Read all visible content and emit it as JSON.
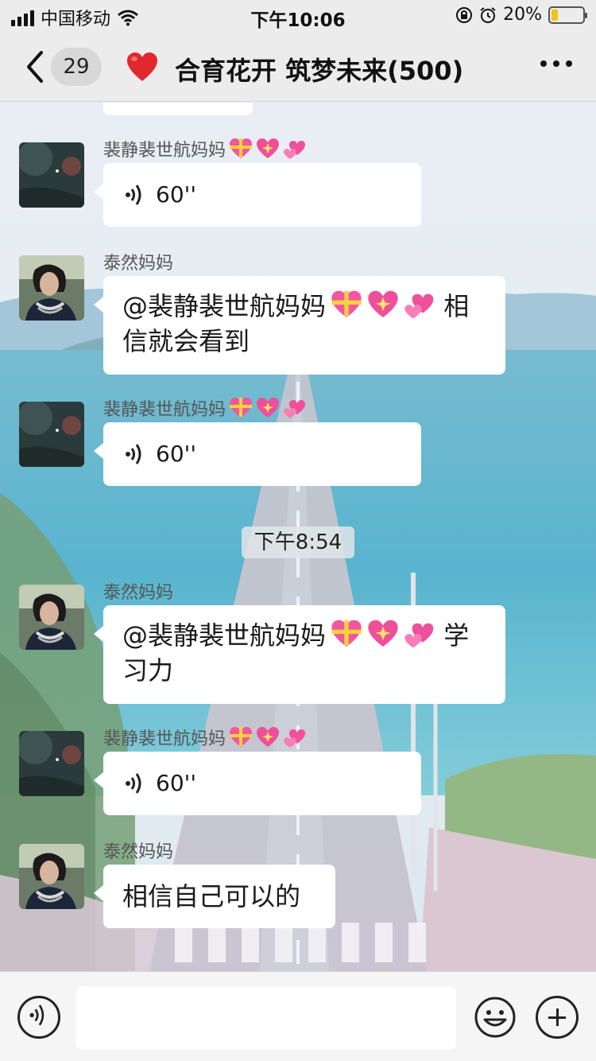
{
  "status_bar": {
    "carrier": "中国移动",
    "time": "下午10:06",
    "battery": "20%",
    "battery_level": 0.2
  },
  "header": {
    "unread_count": "29",
    "title": "合育花开 筑梦未来(500)"
  },
  "messages": [
    {
      "type": "voice",
      "sender": "裴静裴世航妈妈",
      "duration": "60''",
      "avatar": "dark-photo"
    },
    {
      "type": "text",
      "sender": "泰然妈妈",
      "text_line1": "@裴静裴世航妈妈",
      "text_tail": " 相",
      "text_line2": "信就会看到",
      "avatar": "woman-photo"
    },
    {
      "type": "voice",
      "sender": "裴静裴世航妈妈",
      "duration": "60''",
      "avatar": "dark-photo"
    },
    {
      "type": "text",
      "sender": "泰然妈妈",
      "text_line1": "@裴静裴世航妈妈",
      "text_tail": " 学",
      "text_line2": "习力",
      "avatar": "woman-photo"
    },
    {
      "type": "voice",
      "sender": "裴静裴世航妈妈",
      "duration": "60''",
      "avatar": "dark-photo"
    },
    {
      "type": "text",
      "sender": "泰然妈妈",
      "text": "相信自己可以的",
      "avatar": "woman-photo"
    }
  ],
  "timestamp": "下午8:54",
  "emoji_names": [
    "gift-heart-emoji",
    "sparkling-heart-emoji",
    "two-hearts-emoji"
  ],
  "input_bar": {
    "placeholder": ""
  },
  "icons": {
    "back": "chevron-left-icon",
    "more": "more-dots-icon",
    "voice": "voice-mode-icon",
    "emoji": "emoji-icon",
    "plus": "plus-icon"
  },
  "colors": {
    "heart": "#e0282e",
    "bubble": "#ffffff",
    "header_bg": "#ececec"
  }
}
